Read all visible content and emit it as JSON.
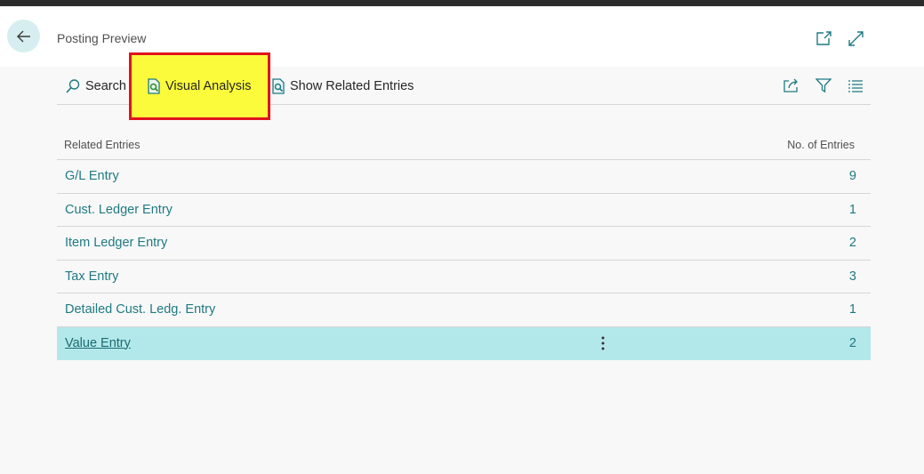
{
  "header": {
    "title": "Posting Preview",
    "icons": [
      "back-arrow-icon",
      "open-new-window-icon",
      "expand-icon"
    ]
  },
  "toolbar": {
    "search_label": "Search",
    "visual_analysis_label": "Visual Analysis",
    "show_related_label": "Show Related Entries",
    "right_icons": [
      "share-icon",
      "filter-icon",
      "list-view-icon"
    ]
  },
  "list": {
    "col_left": "Related Entries",
    "col_right": "No. of Entries",
    "rows": [
      {
        "name": "G/L Entry",
        "count": "9"
      },
      {
        "name": "Cust. Ledger Entry",
        "count": "1"
      },
      {
        "name": "Item Ledger Entry",
        "count": "2"
      },
      {
        "name": "Tax Entry",
        "count": "3"
      },
      {
        "name": "Detailed Cust. Ledg. Entry",
        "count": "1"
      },
      {
        "name": "Value Entry",
        "count": "2"
      }
    ]
  },
  "colors": {
    "accent": "#1f7a82",
    "selected_row": "#b3e8ea",
    "highlight_fill": "#fbfb3c",
    "highlight_border": "#e0141e"
  }
}
